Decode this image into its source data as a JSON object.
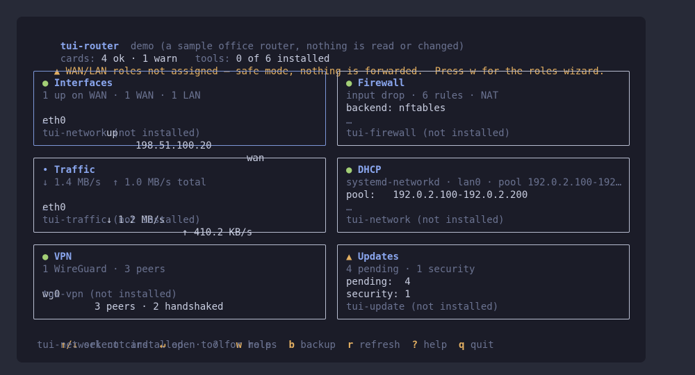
{
  "header": {
    "app_name": "tui-router",
    "subtitle": "demo (a sample office router, nothing is read or changed)",
    "cards_label": "cards:",
    "cards_value": "4 ok · 1 warn",
    "tools_label": "tools:",
    "tools_value": "0 of 6 installed",
    "warning_icon": "▲",
    "warning_text": "WAN/LAN roles not assigned — safe mode, nothing is forwarded.  Press w for the roles wizard."
  },
  "cards": {
    "interfaces": {
      "status_icon": "●",
      "title": "Interfaces",
      "summary": "1 up on WAN · 1 WAN · 1 LAN",
      "row": {
        "name": "eth0",
        "state": "up",
        "address": "198.51.100.20",
        "role": "wan"
      },
      "more": "…",
      "tool": "tui-network (not installed)"
    },
    "firewall": {
      "status_icon": "●",
      "title": "Firewall",
      "summary": "input drop · 6 rules · NAT",
      "detail": "backend: nftables",
      "more": "…",
      "tool": "tui-firewall (not installed)"
    },
    "traffic": {
      "status_icon": "•",
      "title": "Traffic",
      "summary": "↓ 1.4 MB/s  ↑ 1.0 MB/s total",
      "row": {
        "name": "eth0",
        "down": "↓ 1.2 MB/s",
        "up": "↑ 410.2 KB/s"
      },
      "more": "…",
      "tool": "tui-traffic (not installed)"
    },
    "dhcp": {
      "status_icon": "●",
      "title": "DHCP",
      "summary": "systemd-networkd · lan0 · pool 192.0.2.100-192…",
      "detail": "pool:   192.0.2.100-192.0.2.200",
      "more": "…",
      "tool": "tui-network (not installed)"
    },
    "vpn": {
      "status_icon": "●",
      "title": "VPN",
      "summary": "1 WireGuard · 3 peers",
      "row": {
        "name": "wg0",
        "info": "3 peers · 2 handshaked"
      },
      "tool": "tui-vpn (not installed)"
    },
    "updates": {
      "status_icon": "▲",
      "title": "Updates",
      "summary": "4 pending · 1 security",
      "pending": "pending:  4",
      "security": "security: 1",
      "tool": "tui-update (not installed)"
    }
  },
  "footer": {
    "keys": [
      {
        "key": "↑/↓",
        "label": "select card"
      },
      {
        "key": "↵",
        "label": "open tool"
      },
      {
        "key": "w",
        "label": "roles"
      },
      {
        "key": "b",
        "label": "backup"
      },
      {
        "key": "r",
        "label": "refresh"
      },
      {
        "key": "?",
        "label": "help"
      },
      {
        "key": "q",
        "label": "quit"
      }
    ],
    "status_line": "tui-network not installed  ·  ? for help"
  },
  "colors": {
    "background": "#272a37",
    "terminal": "#1b1c28",
    "accent": "#8aa6ee",
    "warn": "#e4b062",
    "ok": "#a3cf76",
    "dim": "#6b7391"
  }
}
